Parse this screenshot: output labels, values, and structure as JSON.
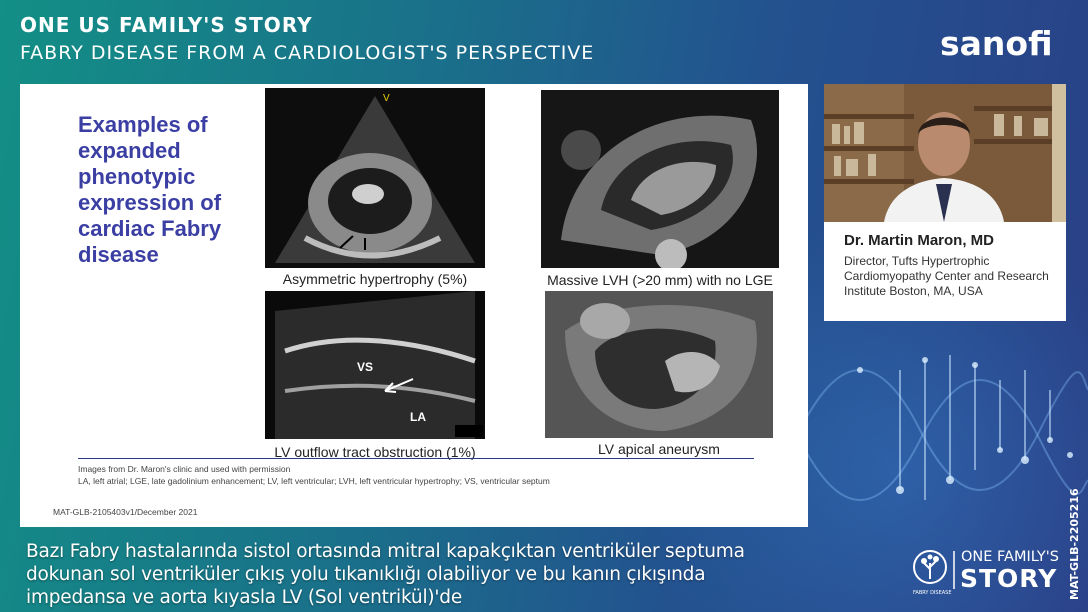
{
  "header": {
    "title": "ONE US FAMILY'S STORY",
    "subtitle": "FABRY DISEASE FROM A CARDIOLOGIST'S PERSPECTIVE",
    "brand": "sanofi"
  },
  "slide": {
    "heading": "Examples of expanded phenotypic expression of cardiac Fabry disease",
    "captions": [
      "Asymmetric hypertrophy (5%)",
      "Massive LVH (>20 mm) with no LGE",
      "LV outflow tract obstruction (1%)",
      "LV apical aneurysm"
    ],
    "image_labels": {
      "vs": "VS",
      "la": "LA",
      "v_marker": "V"
    },
    "footnote_source": "Images from Dr. Maron's clinic and used with permission",
    "footnote_abbrev": "LA, left atrial; LGE, late gadolinium enhancement; LV, left ventricular; LVH, left ventricular hypertrophy; VS, ventricular septum",
    "code": "MAT-GLB-2105403v1/December 2021"
  },
  "speaker": {
    "name": "Dr. Martin Maron, MD",
    "role": "Director, Tufts Hypertrophic Cardiomyopathy Center and Research Institute Boston, MA, USA"
  },
  "subtitles": [
    "Bazı Fabry hastalarında sistol ortasında mitral kapakçıktan ventriküler septuma",
    "dokunan sol ventriküler çıkış yolu tıkanıklığı olabiliyor ve bu kanın çıkışında",
    "impedansa ve aorta kıyasla LV (Sol ventrikül)'de"
  ],
  "footer_logo": {
    "top": "ONE FAMILY'S",
    "bottom": "STORY",
    "small": "FABRY DISEASE"
  },
  "side_code": "MAT-GLB-2205216"
}
